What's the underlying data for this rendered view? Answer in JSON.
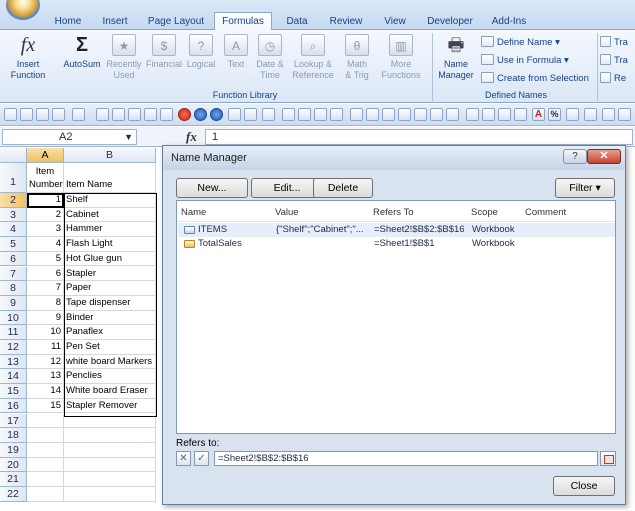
{
  "ribbon": {
    "tabs": [
      "Home",
      "Insert",
      "Page Layout",
      "Formulas",
      "Data",
      "Review",
      "View",
      "Developer",
      "Add-Ins"
    ],
    "active_tab": "Formulas",
    "insert_function": "Insert\nFunction",
    "autosum": "AutoSum",
    "recently_used": "Recently\nUsed",
    "financial": "Financial",
    "logical": "Logical",
    "text": "Text",
    "date_time": "Date &\nTime",
    "lookup_reference": "Lookup &\nReference",
    "math_trig": "Math\n& Trig",
    "more_functions": "More\nFunctions",
    "function_library_label": "Function Library",
    "name_manager": "Name\nManager",
    "define_name": "Define Name",
    "use_in_formula": "Use in Formula",
    "create_from_selection": "Create from Selection",
    "defined_names_label": "Defined Names",
    "trace_1": "Tra",
    "trace_2": "Tra",
    "trace_3": "Re"
  },
  "formula_bar": {
    "name_box": "A2",
    "fx": "fx",
    "value": "1"
  },
  "sheet": {
    "columns": [
      "A",
      "B"
    ],
    "header_a": "Item\nNumber",
    "header_b": "Item Name",
    "rows": [
      {
        "n": "1",
        "name": "Shelf"
      },
      {
        "n": "2",
        "name": "Cabinet"
      },
      {
        "n": "3",
        "name": "Hammer"
      },
      {
        "n": "4",
        "name": "Flash Light"
      },
      {
        "n": "5",
        "name": "Hot Glue gun"
      },
      {
        "n": "6",
        "name": "Stapler"
      },
      {
        "n": "7",
        "name": "Paper"
      },
      {
        "n": "8",
        "name": "Tape dispenser"
      },
      {
        "n": "9",
        "name": "Binder"
      },
      {
        "n": "10",
        "name": "Panaflex"
      },
      {
        "n": "11",
        "name": "Pen Set"
      },
      {
        "n": "12",
        "name": "white board Markers"
      },
      {
        "n": "13",
        "name": "Penclies"
      },
      {
        "n": "14",
        "name": "White board Eraser"
      },
      {
        "n": "15",
        "name": "Stapler Remover"
      }
    ],
    "row_numbers": [
      "1",
      "2",
      "3",
      "4",
      "5",
      "6",
      "7",
      "8",
      "9",
      "10",
      "11",
      "12",
      "13",
      "14",
      "15",
      "16",
      "17",
      "18",
      "19",
      "20",
      "21",
      "22"
    ]
  },
  "dialog": {
    "title": "Name Manager",
    "help": "?",
    "close_x": "✕",
    "new": "New...",
    "edit": "Edit...",
    "delete": "Delete",
    "filter": "Filter",
    "headers": {
      "name": "Name",
      "value": "Value",
      "refers_to": "Refers To",
      "scope": "Scope",
      "comment": "Comment"
    },
    "names": [
      {
        "name": "ITEMS",
        "value": "{\"Shelf\";\"Cabinet\";\"...",
        "refers_to": "=Sheet2!$B$2:$B$16",
        "scope": "Workbook",
        "comment": ""
      },
      {
        "name": "TotalSales",
        "value": "",
        "refers_to": "=Sheet1!$B$1",
        "scope": "Workbook",
        "comment": ""
      }
    ],
    "refers_to_label": "Refers to:",
    "refers_to_value": "=Sheet2!$B$2:$B$16",
    "close": "Close"
  }
}
